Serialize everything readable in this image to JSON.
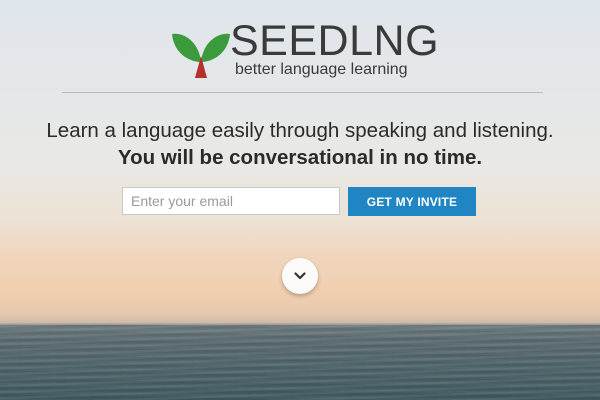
{
  "brand": {
    "name": "SEEDLNG",
    "tagline": "better language learning",
    "colors": {
      "leaf_green": "#3a9a3c",
      "sprout_red": "#b6312c",
      "text": "#3a3a3a"
    }
  },
  "hero": {
    "headline_regular": "Learn a language easily through speaking and listening.",
    "headline_bold": "You will be conversational in no time."
  },
  "signup": {
    "email_placeholder": "Enter your email",
    "email_value": "",
    "button_label": "GET MY INVITE",
    "button_color": "#1f86c3"
  },
  "scroll": {
    "icon": "chevron-down-icon"
  }
}
